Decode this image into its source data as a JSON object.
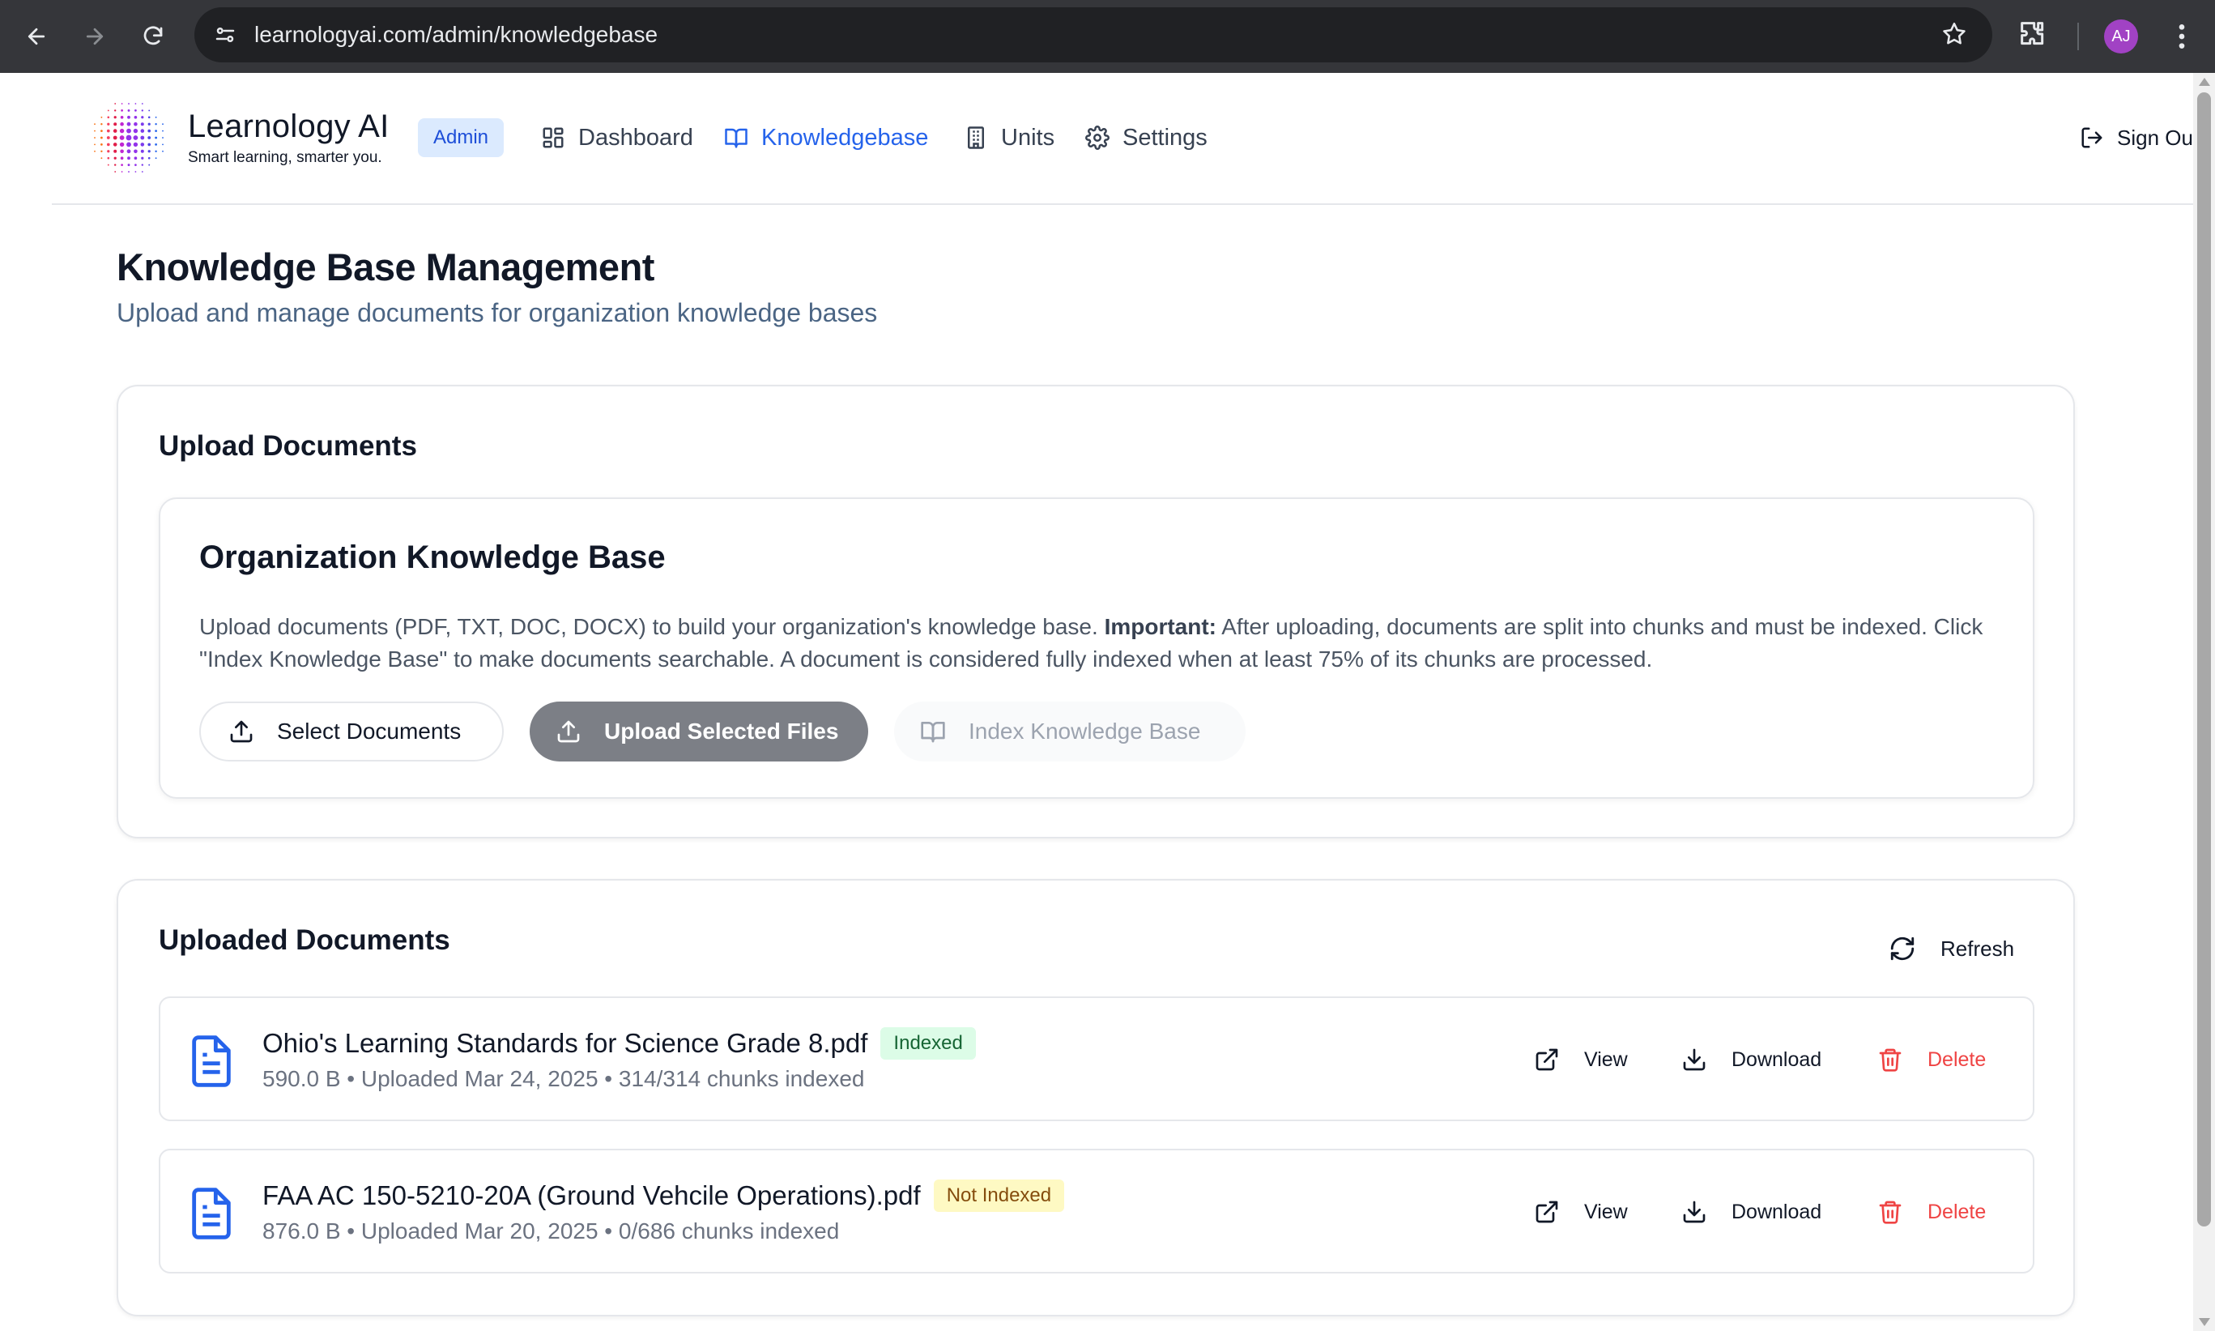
{
  "browser": {
    "url": "learnologyai.com/admin/knowledgebase",
    "avatar_initials": "AJ",
    "avatar_color": "#a142c4"
  },
  "header": {
    "brand_name": "Learnology AI",
    "tagline": "Smart learning, smarter you.",
    "role_badge": "Admin",
    "nav": [
      {
        "label": "Dashboard",
        "icon": "dashboard-icon"
      },
      {
        "label": "Knowledgebase",
        "icon": "book-icon",
        "active": true
      },
      {
        "label": "Units",
        "icon": "building-icon"
      },
      {
        "label": "Settings",
        "icon": "gear-icon"
      }
    ],
    "sign_out": "Sign Ou"
  },
  "page": {
    "title": "Knowledge Base Management",
    "subtitle": "Upload and manage documents for organization knowledge bases"
  },
  "upload": {
    "heading": "Upload Documents",
    "kb_title": "Organization Knowledge Base",
    "desc_intro": "Upload documents (PDF, TXT, DOC, DOCX) to build your organization's knowledge base. ",
    "desc_important": "Important:",
    "desc_rest": " After uploading, documents are split into chunks and must be indexed. Click \"Index Knowledge Base\" to make documents searchable. A document is considered fully indexed when at least 75% of its chunks are processed.",
    "select_label": "Select Documents",
    "upload_label": "Upload Selected Files",
    "index_label": "Index Knowledge Base"
  },
  "documents": {
    "heading": "Uploaded Documents",
    "refresh_label": "Refresh",
    "actions": {
      "view": "View",
      "download": "Download",
      "delete": "Delete"
    },
    "items": [
      {
        "name": "Ohio's Learning Standards for Science Grade 8.pdf",
        "status": "Indexed",
        "meta": "590.0 B • Uploaded Mar 24, 2025 • 314/314 chunks indexed"
      },
      {
        "name": "FAA AC 150-5210-20A (Ground Vehcile Operations).pdf",
        "status": "Not Indexed",
        "meta": "876.0 B • Uploaded Mar 20, 2025 • 0/686 chunks indexed"
      }
    ]
  },
  "colors": {
    "accent": "#2563eb",
    "indexed_badge": "#dcfce7",
    "not_indexed_badge": "#fef9c3",
    "delete": "#ef4444"
  }
}
